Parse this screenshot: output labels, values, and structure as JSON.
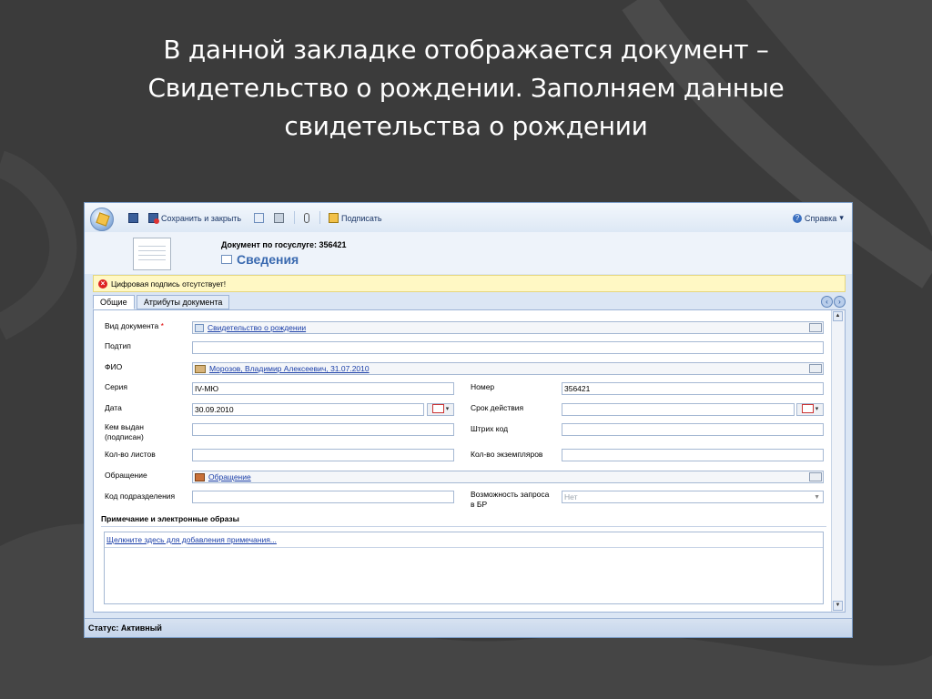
{
  "slide": {
    "title_lines": [
      "В данной закладке отображается документ –",
      "Свидетельство о рождении. Заполняем данные",
      "свидетельства о рождении"
    ]
  },
  "toolbar": {
    "save_close_label": "Сохранить и закрыть",
    "sign_label": "Подписать",
    "help_label": "Справка"
  },
  "header": {
    "subtitle": "Документ по госуслуге: 356421",
    "title": "Сведения"
  },
  "notice": {
    "text": "Цифровая подпись отсутствует!"
  },
  "tabs": [
    {
      "label": "Общие",
      "active": true
    },
    {
      "label": "Атрибуты документа",
      "active": false
    }
  ],
  "form": {
    "doc_type": {
      "label": "Вид документа",
      "required_mark": "*",
      "value": "Свидетельство о рождении"
    },
    "subtype": {
      "label": "Подтип",
      "value": ""
    },
    "fio": {
      "label": "ФИО",
      "value": "Морозов, Владимир Алексеевич, 31.07.2010"
    },
    "series": {
      "label": "Серия",
      "value": "IV-МЮ"
    },
    "number": {
      "label": "Номер",
      "value": "356421"
    },
    "date": {
      "label": "Дата",
      "value": "30.09.2010"
    },
    "validity": {
      "label": "Срок действия",
      "value": ""
    },
    "issued_by": {
      "label_line1": "Кем выдан",
      "label_line2": "(подписан)",
      "value": ""
    },
    "barcode": {
      "label": "Штрих код",
      "value": ""
    },
    "sheets": {
      "label": "Кол-во листов",
      "value": ""
    },
    "copies": {
      "label": "Кол-во экземпляров",
      "value": ""
    },
    "appeal": {
      "label": "Обращение",
      "value": "Обращение"
    },
    "dept_code": {
      "label": "Код подразделения",
      "value": ""
    },
    "request_br": {
      "label_line1": "Возможность запроса",
      "label_line2": "в БР",
      "value": "Нет"
    }
  },
  "notes_section": {
    "title": "Примечание и электронные образы",
    "add_link": "Щелкните здесь для добавления примечания..."
  },
  "status": {
    "text": "Статус: Активный"
  }
}
